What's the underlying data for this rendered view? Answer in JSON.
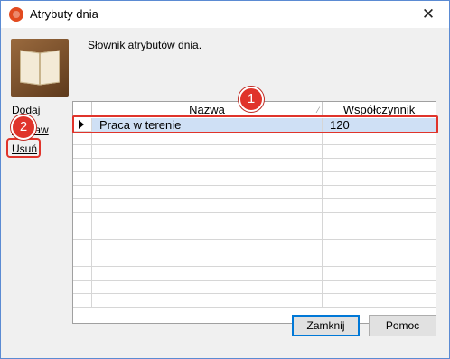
{
  "window": {
    "title": "Atrybuty dnia",
    "close_glyph": "✕"
  },
  "description": "Słownik atrybutów dnia.",
  "side_links": {
    "add": "Dodaj",
    "edit": "Popraw",
    "delete": "Usuń"
  },
  "grid": {
    "columns": [
      "Nazwa",
      "Współczynnik"
    ],
    "sort_glyph": "⁄",
    "rows": [
      {
        "name": "Praca w terenie",
        "factor": "120",
        "selected": true
      }
    ]
  },
  "markers": {
    "one": "1",
    "two": "2"
  },
  "buttons": {
    "close": "Zamknij",
    "help": "Pomoc"
  },
  "colors": {
    "highlight": "#e0342b",
    "selected_row": "#cfe0f5",
    "window_border": "#5b8bd3"
  }
}
